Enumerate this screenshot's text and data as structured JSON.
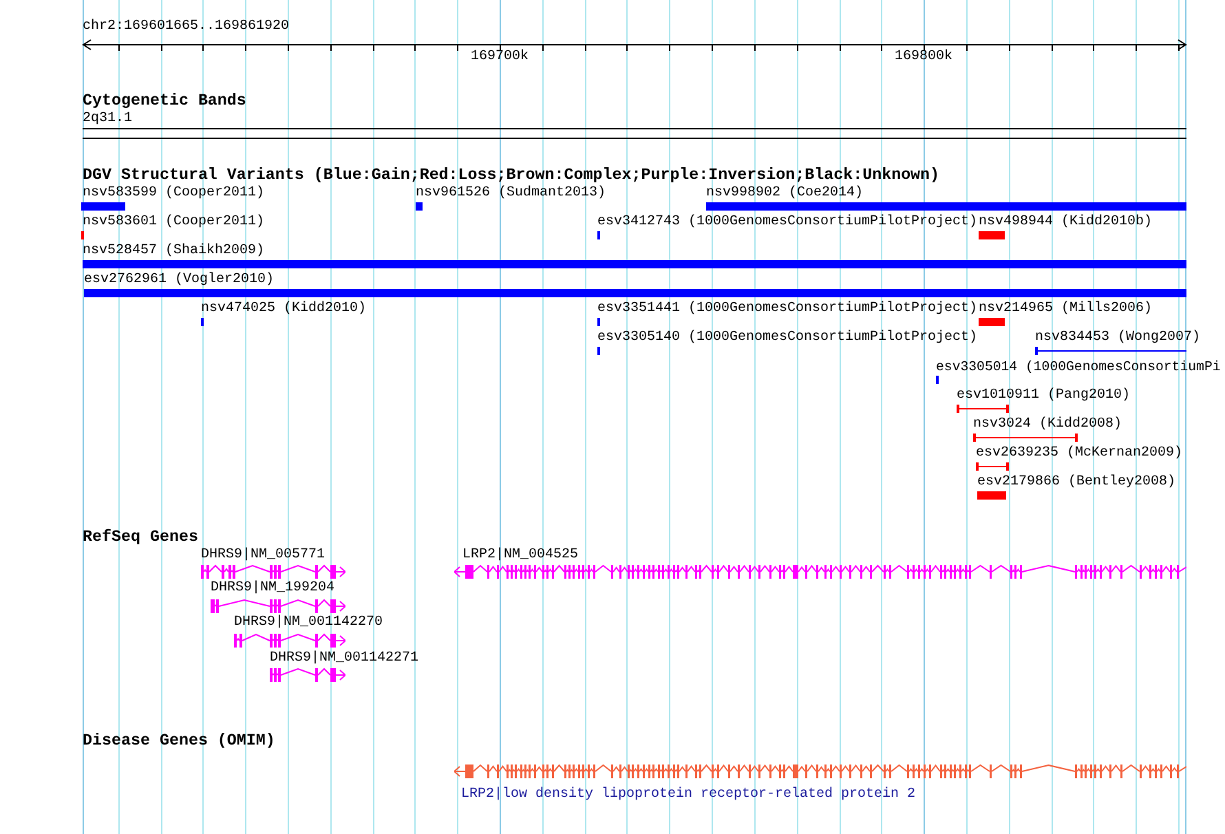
{
  "ruler": {
    "location": "chr2:169601665..169861920",
    "ticks": [
      "169700k",
      "169800k"
    ]
  },
  "tracks": [
    {
      "kind": "cytoband",
      "title": "Cytogenetic Bands",
      "bands": [
        {
          "label": "2q31.1"
        }
      ]
    },
    {
      "kind": "variants",
      "title": "DGV Structural Variants (Blue:Gain;Red:Loss;Brown:Complex;Purple:Inversion;Black:Unknown)",
      "features": [
        {
          "label": "nsv583599 (Cooper2011)",
          "color": "#0000ff",
          "kind": "block"
        },
        {
          "label": "nsv961526 (Sudmant2013)",
          "color": "#0000ff",
          "kind": "block"
        },
        {
          "label": "nsv998902 (Coe2014)",
          "color": "#0000ff",
          "kind": "block"
        },
        {
          "label": "nsv583601 (Cooper2011)",
          "color": "#ff0000",
          "kind": "block"
        },
        {
          "label": "esv3412743 (1000GenomesConsortiumPilotProject)",
          "color": "#0000ff",
          "kind": "block"
        },
        {
          "label": "nsv498944 (Kidd2010b)",
          "color": "#ff0000",
          "kind": "block"
        },
        {
          "label": "nsv528457 (Shaikh2009)",
          "color": "#0000ff",
          "kind": "block"
        },
        {
          "label": "esv2762961 (Vogler2010)",
          "color": "#0000ff",
          "kind": "block"
        },
        {
          "label": "nsv474025 (Kidd2010)",
          "color": "#0000ff",
          "kind": "block"
        },
        {
          "label": "esv3351441 (1000GenomesConsortiumPilotProject)",
          "color": "#0000ff",
          "kind": "block"
        },
        {
          "label": "nsv214965 (Mills2006)",
          "color": "#ff0000",
          "kind": "block"
        },
        {
          "label": "esv3305140 (1000GenomesConsortiumPilotProject)",
          "color": "#0000ff",
          "kind": "block"
        },
        {
          "label": "nsv834453 (Wong2007)",
          "color": "#0000ff",
          "kind": "span"
        },
        {
          "label": "esv3305014 (1000GenomesConsortiumPi",
          "color": "#0000ff",
          "kind": "block"
        },
        {
          "label": "esv1010911 (Pang2010)",
          "color": "#ff0000",
          "kind": "span"
        },
        {
          "label": "nsv3024 (Kidd2008)",
          "color": "#ff0000",
          "kind": "span"
        },
        {
          "label": "esv2639235 (McKernan2009)",
          "color": "#ff0000",
          "kind": "span"
        },
        {
          "label": "esv2179866 (Bentley2008)",
          "color": "#ff0000",
          "kind": "block"
        }
      ]
    },
    {
      "kind": "genes",
      "title": "RefSeq Genes",
      "features": [
        {
          "label": "DHRS9|NM_005771",
          "reverse": false
        },
        {
          "label": "LRP2|NM_004525",
          "reverse": true
        },
        {
          "label": "DHRS9|NM_199204",
          "reverse": false
        },
        {
          "label": "DHRS9|NM_001142270",
          "reverse": false
        },
        {
          "label": "DHRS9|NM_001142271",
          "reverse": false
        }
      ]
    },
    {
      "kind": "disease_genes",
      "title": "Disease Genes (OMIM)",
      "features": [
        {
          "label": "LRP2|low density lipoprotein receptor-related protein 2",
          "reverse": true
        }
      ]
    }
  ]
}
